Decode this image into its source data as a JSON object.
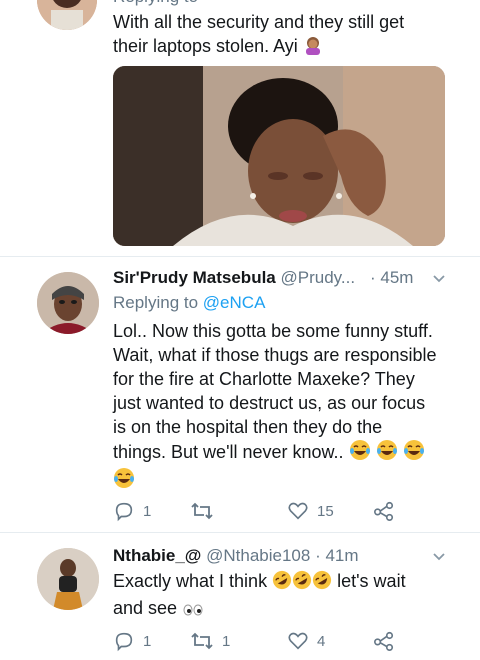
{
  "tweets": [
    {
      "text": "With all the security and they still get their laptops stolen. Ayi",
      "line1": "With all the security and they still get",
      "line2": "their laptops stolen. Ayi",
      "partial_header": "Replying to"
    },
    {
      "name": "Sir'Prudy Matsebula",
      "handle": "@Prudy...",
      "time": "· 45m",
      "reply_prefix": "Replying to",
      "reply_mention": "@eNCA",
      "lines": [
        "Lol.. Now this gotta be some funny stuff.",
        "Wait, what if those thugs are responsible",
        "for the fire at Charlotte Maxeke? They",
        "just wanted to destruct us, as our focus",
        "is on the hospital then they do the",
        "things. But we'll never know.."
      ],
      "reply_count": "1",
      "retweet_count": "",
      "like_count": "15"
    },
    {
      "name": "Nthabie_@",
      "handle": "@Nthabie108",
      "time": "· 41m",
      "line1": "Exactly what I think",
      "line1_tail": "let's wait",
      "line2": "and see",
      "reply_count": "1",
      "retweet_count": "1",
      "like_count": "4"
    }
  ],
  "colors": {
    "link": "#1da1f2",
    "secondary": "#657786",
    "divider": "#e6ecf0"
  }
}
